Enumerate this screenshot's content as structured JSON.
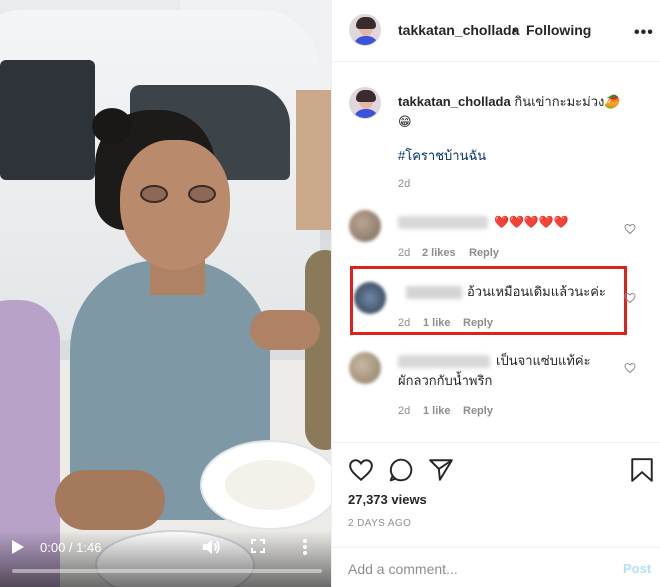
{
  "video": {
    "current_time": "0:00",
    "separator": " / ",
    "duration": "1:46",
    "progress": 0.0
  },
  "header": {
    "username": "takkatan_chollada",
    "dot": "•",
    "follow_status": "Following",
    "more_glyph": "•••"
  },
  "caption": {
    "username": "takkatan_chollada",
    "text": "กินเข่ากะมะม่วง",
    "emoji_1": "🥭",
    "emoji_2": "😁",
    "hashtag": "#โคราชบ้านฉัน",
    "time": "2d"
  },
  "comments": [
    {
      "text": "❤️❤️❤️❤️❤️",
      "time": "2d",
      "likes": "2 likes",
      "reply": "Reply"
    },
    {
      "text": "อ้วนเหมือนเดิมแล้วนะค่ะ",
      "time": "2d",
      "likes": "1 like",
      "reply": "Reply",
      "highlighted": true
    },
    {
      "text_line1": "เป็นจาแซ่บแท้ค่ะ",
      "text_line2": "ผักลวกกับน้ำพริก",
      "time": "2d",
      "likes": "1 like",
      "reply": "Reply"
    }
  ],
  "actions": {
    "views": "27,373 views",
    "posted": "2 DAYS AGO",
    "comment_placeholder": "Add a comment...",
    "post_label": "Post"
  },
  "colors": {
    "highlight_border": "#e0201c",
    "link": "#003569",
    "muted": "#8e8e8e",
    "post_disabled": "#b2dffc"
  },
  "icons": [
    "play-icon",
    "volume-icon",
    "fullscreen-icon",
    "more-vertical-icon",
    "more-horizontal-icon",
    "heart-icon",
    "comment-icon",
    "share-icon",
    "bookmark-icon"
  ]
}
